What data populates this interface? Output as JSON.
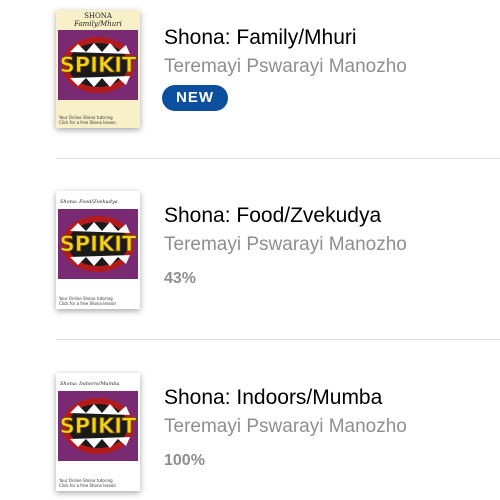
{
  "books": [
    {
      "title": "Shona: Family/Mhuri",
      "author": "Teremayi Pswarayi Manozho",
      "badge": "NEW",
      "cover": {
        "heading_line1": "SHONA",
        "heading_line2": "Family/Mhuri",
        "logo_text": "SPIKIT",
        "footer_line1": "Your Online Shona tutoring",
        "footer_line2": "Click for a free Shona lesson"
      }
    },
    {
      "title": "Shona: Food/Zvekudya",
      "author": "Teremayi Pswarayi Manozho",
      "progress": "43%",
      "cover": {
        "heading": "Shona: Food/Zvekudya",
        "logo_text": "SPIKIT",
        "footer_line1": "Your Online Shona tutoring",
        "footer_line2": "Click for a free Shona lesson"
      }
    },
    {
      "title": "Shona: Indoors/Mumba",
      "author": "Teremayi Pswarayi Manozho",
      "progress": "100%",
      "cover": {
        "heading": "Shona: Indoors/Mumba",
        "logo_text": "SPIKIT",
        "footer_line1": "Your Online Shona tutoring",
        "footer_line2": "Click for a free Shona lesson"
      }
    }
  ],
  "colors": {
    "badge_bg": "#0b4f9e",
    "secondary_text": "#8e8e93",
    "cover_art_bg": "#7a2a72",
    "logo_yellow": "#f2d21b"
  }
}
